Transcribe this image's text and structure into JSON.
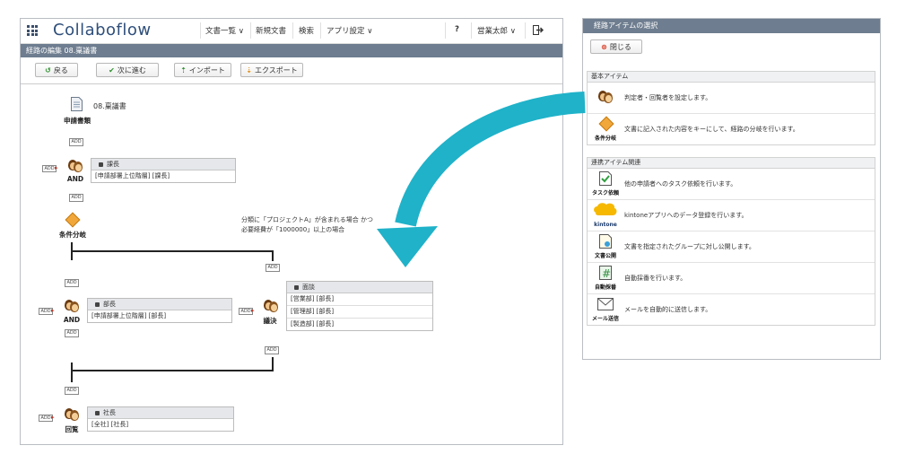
{
  "topbar": {
    "logo": "Collaboflow",
    "nav": {
      "documents": "文書一覧 ∨",
      "new_doc": "新規文書",
      "search": "検索",
      "app_settings": "アプリ設定 ∨",
      "help": "?",
      "user": "営業太郎 ∨"
    }
  },
  "titlebar": {
    "text": "経路の編集 08.稟議書"
  },
  "toolbar": {
    "back": "戻る",
    "next": "次に進む",
    "import": "インポート",
    "export": "エクスポート"
  },
  "route": {
    "form_icon_label": "申請書類",
    "form_name": "08.稟議書",
    "add_tag": "ADD",
    "node1": {
      "label": "AND",
      "role": "課長",
      "rows": [
        "[申請部署上位階層] [課長]"
      ]
    },
    "branch": {
      "label": "条件分岐",
      "condition_line1": "分類に「プロジェクトA」が含まれる場合 かつ",
      "condition_line2": "必要経費が「1000000」以上の場合"
    },
    "node2": {
      "label": "AND",
      "role": "部長",
      "rows": [
        "[申請部署上位階層] [部長]"
      ]
    },
    "node3": {
      "label": "議決",
      "role": "面談",
      "rows": [
        "[営業部] [部長]",
        "[管理部] [部長]",
        "[製造部] [部長]"
      ]
    },
    "node4": {
      "label": "回覧",
      "role": "社長",
      "rows": [
        "[全社] [社長]"
      ]
    }
  },
  "panel": {
    "title": "経路アイテムの選択",
    "close": "閉じる",
    "basic_section": "基本アイテム",
    "basic_items": [
      {
        "caption": "",
        "desc": "判定者・回覧者を設定します。"
      },
      {
        "caption": "条件分岐",
        "desc": "文書に記入された内容をキーにして、経路の分岐を行います。"
      }
    ],
    "linked_section": "連携アイテム関連",
    "linked_items": [
      {
        "caption": "タスク依頼",
        "desc": "他の申請者へのタスク依頼を行います。"
      },
      {
        "caption": "kintone",
        "desc": "kintoneアプリへのデータ登録を行います。"
      },
      {
        "caption": "文書公開",
        "desc": "文書を指定されたグループに対し公開します。"
      },
      {
        "caption": "自動採番",
        "desc": "自動採番を行います。"
      },
      {
        "caption": "メール送信",
        "desc": "メールを自動的に送信します。"
      }
    ]
  },
  "colors": {
    "header": "#6e7d8f",
    "arrow": "#1fb2c9",
    "kintone": "#f6b800"
  }
}
